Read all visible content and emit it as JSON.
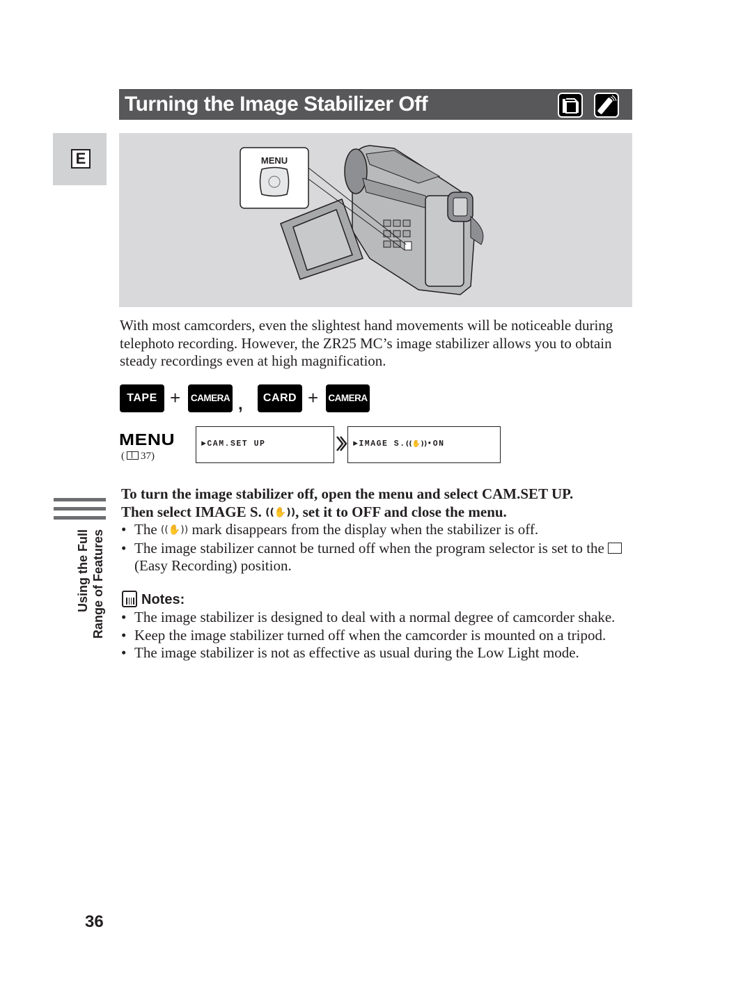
{
  "header": {
    "title": "Turning the Image Stabilizer Off",
    "icons": [
      "camcorder-icon",
      "remote-control-icon"
    ]
  },
  "language_tab": "E",
  "illustration": {
    "callout_label": "MENU",
    "description": "Camcorder with open LCD panel; MENU button callout"
  },
  "intro_text": "With most camcorders, even the slightest hand movements will be noticeable during telephoto recording. However, the ZR25 MC’s image stabilizer allows you to obtain steady recordings even at high magnification.",
  "modes": {
    "key1": "TAPE",
    "plus": "+",
    "key2": "CAMERA",
    "separator": ",",
    "key3": "CARD",
    "key4": "CAMERA"
  },
  "menu": {
    "label": "MENU",
    "ref_open": "(",
    "ref_page": "37)",
    "screen1": "►CAM.SET UP",
    "screen2_prefix": "►IMAGE S.",
    "screen2_icon": "((✋))",
    "screen2_suffix": "•ON"
  },
  "instruction": {
    "line1": "To turn the image stabilizer off, open the menu and select CAM.SET UP.",
    "line2_a": "Then select IMAGE S. ",
    "line2_icon": "((✋))",
    "line2_b": ", set it to OFF and close the menu."
  },
  "bullets": [
    {
      "a": "The ",
      "icon": "((✋))",
      "b": " mark disappears from the display when the stabilizer is off."
    },
    {
      "a": "The image stabilizer cannot be turned off when the program selector is set to the ",
      "b": " (Easy Recording) position."
    }
  ],
  "notes": {
    "heading": "Notes:",
    "items": [
      "The image stabilizer is designed to deal with a normal degree of camcorder shake.",
      "Keep the image stabilizer turned off when the camcorder is mounted on a tripod.",
      "The image stabilizer is not as effective as usual during the Low Light mode."
    ]
  },
  "side_section": {
    "line1": "Using the Full",
    "line2": "Range of Features"
  },
  "page_number": "36"
}
